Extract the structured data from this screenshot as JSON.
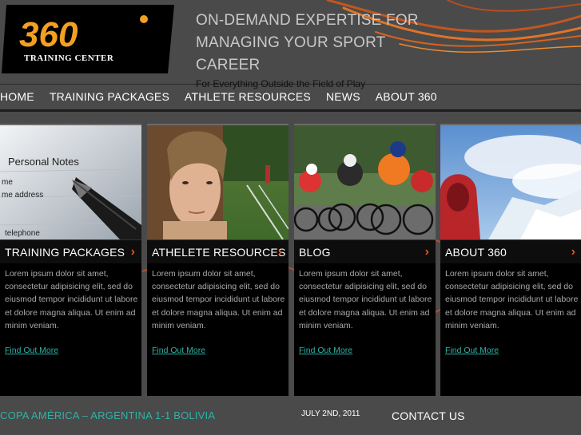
{
  "header": {
    "logo_numbers": "360",
    "logo_caption": "TRAINING CENTER",
    "tagline": "ON-DEMAND EXPERTISE FOR MANAGING YOUR SPORT CAREER",
    "subtagline": "For Everything Outside the Field of Play"
  },
  "nav": {
    "items": [
      {
        "label": "HOME"
      },
      {
        "label": "TRAINING PACKAGES"
      },
      {
        "label": "ATHLETE RESOURCES"
      },
      {
        "label": "NEWS"
      },
      {
        "label": "ABOUT 360"
      }
    ]
  },
  "cards": [
    {
      "title": "TRAINING PACKAGES",
      "body": "Lorem ipsum dolor sit amet, consectetur adipisicing elit, sed do eiusmod tempor incididunt ut labore et dolore magna aliqua. Ut enim ad minim veniam.",
      "link": "Find Out More",
      "photo_text": [
        "Personal Notes",
        "me",
        "me address",
        "telephone"
      ]
    },
    {
      "title": "ATHELETE RESOURCES",
      "body": "Lorem ipsum dolor sit amet, consectetur adipisicing elit, sed do eiusmod tempor incididunt ut labore et dolore magna aliqua. Ut enim ad minim veniam.",
      "link": "Find Out More"
    },
    {
      "title": "BLOG",
      "body": "Lorem ipsum dolor sit amet, consectetur adipisicing elit, sed do eiusmod tempor incididunt ut labore et dolore magna aliqua. Ut enim ad minim veniam.",
      "link": "Find Out More"
    },
    {
      "title": "ABOUT 360",
      "body": "Lorem ipsum dolor sit amet, consectetur adipisicing elit, sed do eiusmod tempor incididunt ut labore et dolore magna aliqua. Ut enim ad minim veniam.",
      "link": "Find Out More"
    }
  ],
  "footer": {
    "news": "COPA AMÉRICA – ARGENTINA 1-1 BOLIVIA",
    "date": "JULY 2ND, 2011",
    "contact": "CONTACT US"
  },
  "colors": {
    "accent_orange": "#e2561d",
    "link_teal": "#2fb2a4",
    "background": "#4a4a4a"
  },
  "icons": {
    "card_arrow": "chevron-right-icon"
  }
}
